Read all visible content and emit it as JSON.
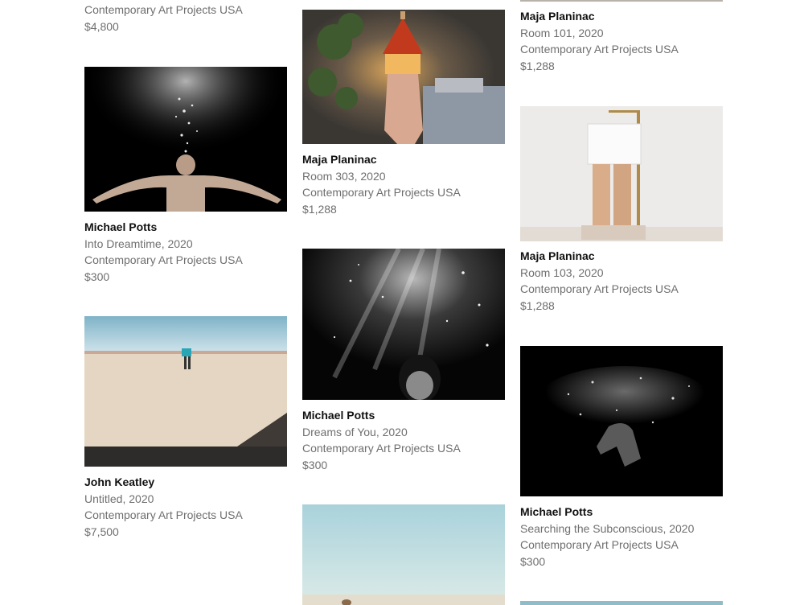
{
  "artworks": [
    {
      "artist": "",
      "title": "",
      "gallery": "Contemporary Art Projects USA",
      "price": "$4,800"
    },
    {
      "artist": "Michael Potts",
      "title": "Into Dreamtime, 2020",
      "gallery": "Contemporary Art Projects USA",
      "price": "$300"
    },
    {
      "artist": "John Keatley",
      "title": "Untitled, 2020",
      "gallery": "Contemporary Art Projects USA",
      "price": "$7,500"
    },
    {
      "artist": "Maja Planinac",
      "title": "Room 303, 2020",
      "gallery": "Contemporary Art Projects USA",
      "price": "$1,288"
    },
    {
      "artist": "Michael Potts",
      "title": "Dreams of You, 2020",
      "gallery": "Contemporary Art Projects USA",
      "price": "$300"
    },
    {
      "artist": "",
      "title": "",
      "gallery": "",
      "price": ""
    },
    {
      "artist": "Maja Planinac",
      "title": "Room 101, 2020",
      "gallery": "Contemporary Art Projects USA",
      "price": "$1,288"
    },
    {
      "artist": "Maja Planinac",
      "title": "Room 103, 2020",
      "gallery": "Contemporary Art Projects USA",
      "price": "$1,288"
    },
    {
      "artist": "Michael Potts",
      "title": "Searching the Subconscious, 2020",
      "gallery": "Contemporary Art Projects USA",
      "price": "$300"
    },
    {
      "artist": "",
      "title": "",
      "gallery": "",
      "price": ""
    }
  ],
  "colors": {
    "artist_text": "#111111",
    "secondary_text": "#6f6f6f",
    "background": "#ffffff"
  }
}
